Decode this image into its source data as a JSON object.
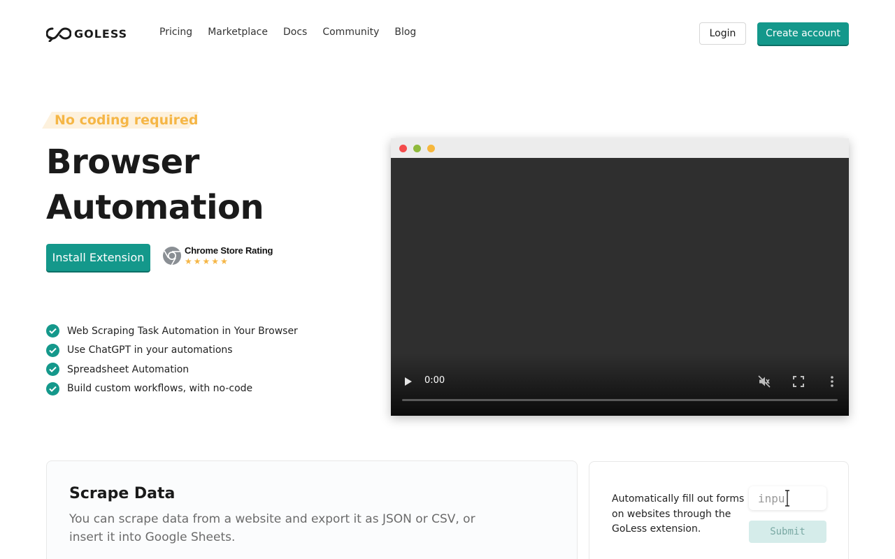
{
  "nav": {
    "logo_text": "GOLESS",
    "links": [
      "Pricing",
      "Marketplace",
      "Docs",
      "Community",
      "Blog"
    ],
    "login_label": "Login",
    "create_account_label": "Create account"
  },
  "hero": {
    "tag": "No coding required",
    "title": "Browser Automation",
    "install_label": "Install Extension",
    "rating_label": "Chrome Store Rating",
    "rating_stars": 5,
    "features": [
      "Web Scraping Task Automation in Your Browser",
      "Use ChatGPT in your automations",
      "Spreadsheet Automation",
      "Build custom workflows, with no-code"
    ]
  },
  "video": {
    "time": "0:00"
  },
  "cards": {
    "scrape": {
      "title": "Scrape Data",
      "description": "You can scrape data from a website and export it as JSON or CSV, or insert it into Google Sheets."
    },
    "form": {
      "description": "Automatically fill out forms on websites through the GoLess extension.",
      "input_value": "inpu",
      "submit_label": "Submit"
    }
  },
  "colors": {
    "brand": "#14988b",
    "tag_text": "#f5b646",
    "tag_bg": "#fdf1dd",
    "star": "#f5b646",
    "window_close": "#f44b4b",
    "window_min": "#8fba3c",
    "window_max": "#f6b73c"
  },
  "icons": {
    "logo": "goless-infinity-logo-icon",
    "rating": "chrome-icon",
    "check": "check-circle-icon",
    "play": "play-icon",
    "mute": "volume-muted-icon",
    "fullscreen": "fullscreen-icon",
    "more": "more-vertical-icon",
    "cursor": "text-cursor-icon"
  }
}
